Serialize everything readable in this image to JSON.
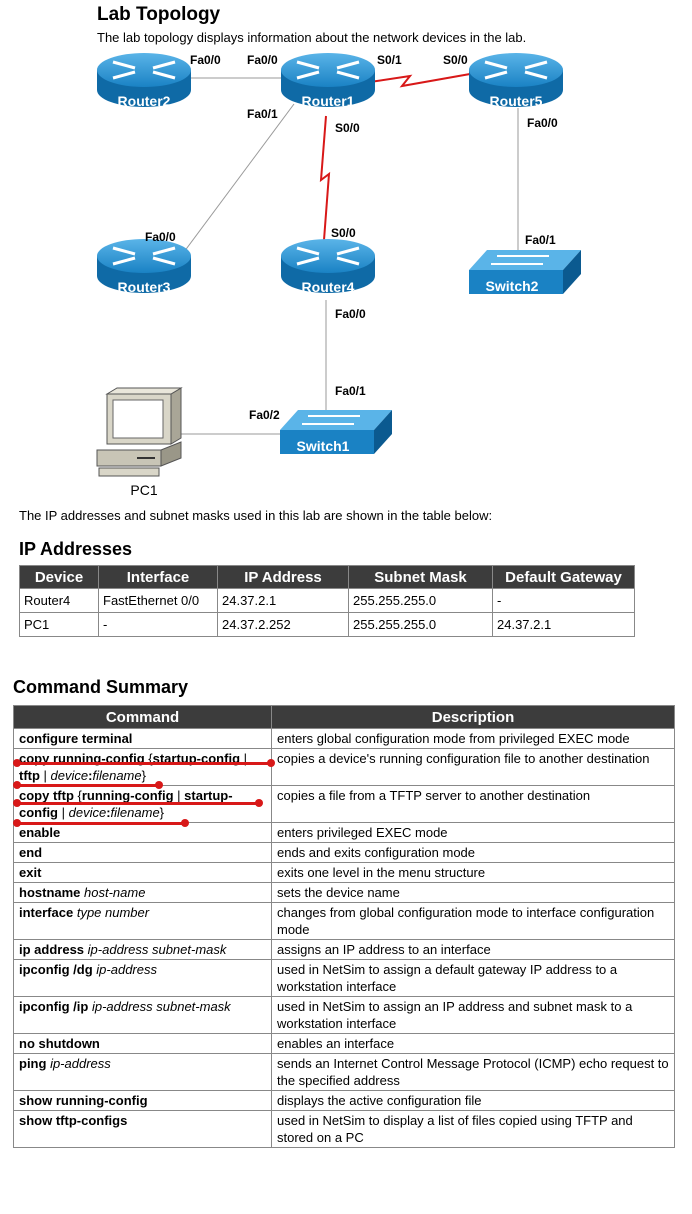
{
  "topology": {
    "heading": "Lab Topology",
    "intro": "The lab topology displays information about the network devices in the lab.",
    "devices": {
      "router1": "Router1",
      "router2": "Router2",
      "router3": "Router3",
      "router4": "Router4",
      "router5": "Router5",
      "switch1": "Switch1",
      "switch2": "Switch2",
      "pc1": "PC1"
    },
    "ports": {
      "r2_fa00": "Fa0/0",
      "r1_fa00": "Fa0/0",
      "r1_s01": "S0/1",
      "r5_s00": "S0/0",
      "r1_fa01": "Fa0/1",
      "r1_s00": "S0/0",
      "r5_fa00": "Fa0/0",
      "r3_fa00": "Fa0/0",
      "r4_s00": "S0/0",
      "sw2_fa01": "Fa0/1",
      "r4_fa00": "Fa0/0",
      "sw1_fa01": "Fa0/1",
      "sw1_fa02": "Fa0/2"
    },
    "colors": {
      "device_blue": "#1a82c4",
      "serial_link": "#d81818",
      "link": "#9a9a9a"
    }
  },
  "ip_section": {
    "intro": "The IP addresses and subnet masks used in this lab are shown in the table below:",
    "heading": "IP Addresses",
    "columns": [
      "Device",
      "Interface",
      "IP Address",
      "Subnet Mask",
      "Default Gateway"
    ],
    "rows": [
      [
        "Router4",
        "FastEthernet 0/0",
        "24.37.2.1",
        "255.255.255.0",
        "-"
      ],
      [
        "PC1",
        "-",
        "24.37.2.252",
        "255.255.255.0",
        "24.37.2.1"
      ]
    ]
  },
  "command_summary": {
    "heading": "Command Summary",
    "columns": [
      "Command",
      "Description"
    ],
    "rows": [
      {
        "cmd": "configure terminal",
        "args": "",
        "desc": "enters global configuration mode from privileged EXEC mode"
      },
      {
        "cmd": "copy running-config",
        "args": "",
        "desc": "copies a device's running configuration file to another destination"
      },
      {
        "cmd": "copy tftp",
        "args": "",
        "desc": "copies a file from a TFTP server to another destination"
      },
      {
        "cmd": "enable",
        "args": "",
        "desc": "enters privileged EXEC mode"
      },
      {
        "cmd": "end",
        "args": "",
        "desc": "ends and exits configuration mode"
      },
      {
        "cmd": "exit",
        "args": "",
        "desc": "exits one level in the menu structure"
      },
      {
        "cmd": "hostname",
        "args": "host-name",
        "desc": "sets the device name"
      },
      {
        "cmd": "interface",
        "args": "type number",
        "desc": "changes from global configuration mode to interface configuration mode"
      },
      {
        "cmd": "ip address",
        "args": "ip-address subnet-mask",
        "desc": "assigns an IP address to an interface"
      },
      {
        "cmd": "ipconfig /dg",
        "args": "ip-address",
        "desc": "used in NetSim to assign a default gateway IP address to a workstation interface"
      },
      {
        "cmd": "ipconfig /ip",
        "args": "ip-address subnet-mask",
        "desc": "used in NetSim to assign an IP address and subnet mask to a workstation interface"
      },
      {
        "cmd": "no shutdown",
        "args": "",
        "desc": "enables an interface"
      },
      {
        "cmd": "ping",
        "args": "ip-address",
        "desc": "sends an Internet Control Message Protocol (ICMP) echo request to the specified address"
      },
      {
        "cmd": "show running-config",
        "args": "",
        "desc": "displays the active configuration file"
      },
      {
        "cmd": "show tftp-configs",
        "args": "",
        "desc": "used in NetSim to display a list of files copied using TFTP and stored on a PC"
      }
    ],
    "copy_running": {
      "open": "{",
      "opt1": "startup-config",
      "sep": " | ",
      "opt2": "tftp",
      "sep2": " | ",
      "device": "device",
      "colon": ":",
      "filename": "filename",
      "close": "}"
    },
    "copy_tftp": {
      "open": "{",
      "opt1": "running-config",
      "sep": " | ",
      "opt2": "startup-config",
      "sep2": " | ",
      "device": "device",
      "colon": ":",
      "filename": "filename",
      "close": "}"
    }
  }
}
